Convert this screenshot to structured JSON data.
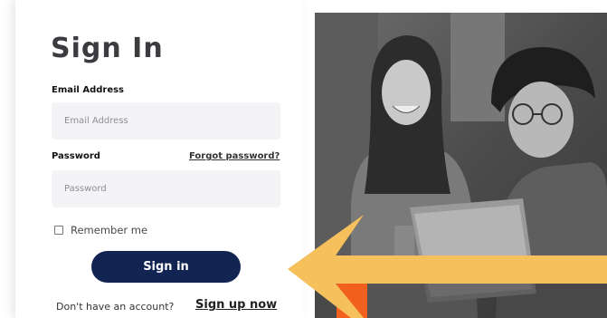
{
  "signin": {
    "title": "Sign In",
    "email_label": "Email Address",
    "email_placeholder": "Email Address",
    "password_label": "Password",
    "password_placeholder": "Password",
    "forgot_link": "Forgot password?",
    "remember_label": "Remember me",
    "remember_checked": false,
    "button_label": "Sign in",
    "footer_prompt": "Don't have an account?",
    "signup_link": "Sign up now"
  },
  "colors": {
    "button": "#122451",
    "arrow": "#f6c15c",
    "accent_orange": "#f2601f",
    "input_bg": "#f4f4f6"
  }
}
